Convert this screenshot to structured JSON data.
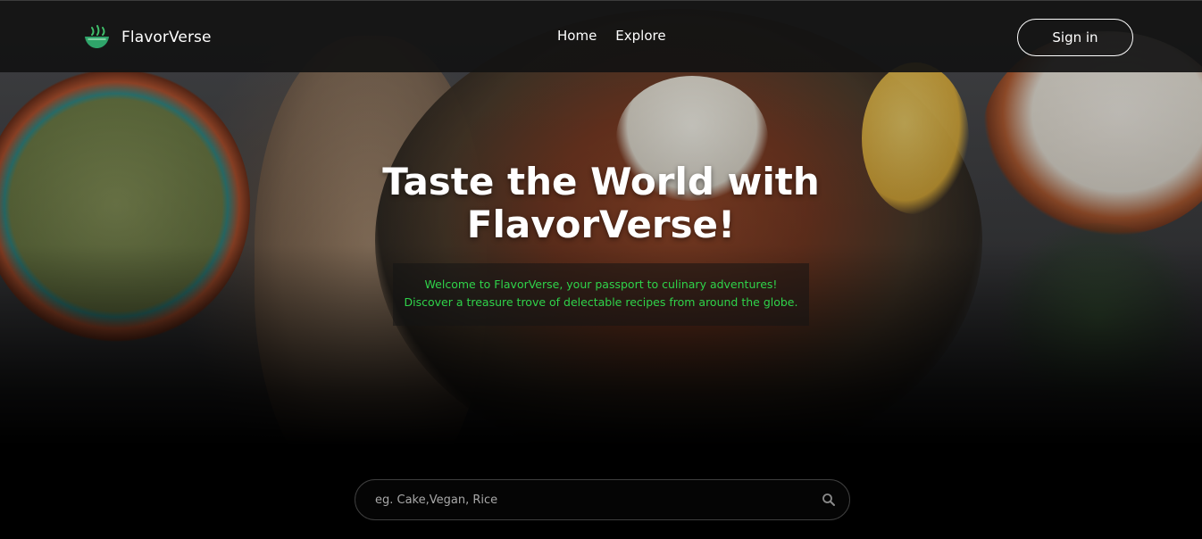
{
  "navbar": {
    "brand": {
      "name": "FlavorVerse",
      "icon": "bowl-logo-icon"
    },
    "links": [
      {
        "label": "Home"
      },
      {
        "label": "Explore"
      }
    ],
    "signin_label": "Sign in"
  },
  "hero": {
    "title_line1": "Taste the World with",
    "title_line2": "FlavorVerse!",
    "subtitle_line1": "Welcome to FlavorVerse, your passport to culinary adventures!",
    "subtitle_line2": "Discover a treasure trove of delectable recipes from around the globe."
  },
  "search": {
    "placeholder": "eg. Cake,Vegan, Rice",
    "value": "",
    "icon": "search-icon"
  },
  "colors": {
    "accent_green": "#2fd34a",
    "navbar_bg": "#121212",
    "text_white": "#ffffff",
    "page_bg": "#000000"
  }
}
